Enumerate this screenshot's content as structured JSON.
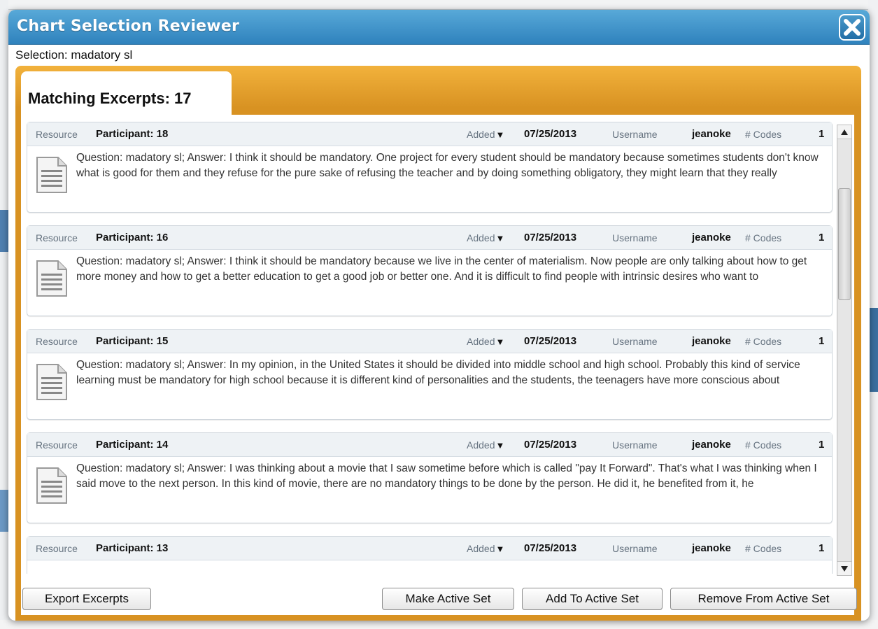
{
  "dialog": {
    "title": "Chart Selection Reviewer",
    "selection_text": "Selection: madatory sl",
    "tab_label": "Matching Excerpts: 17",
    "close_icon": "close-x-icon"
  },
  "columns": {
    "resource_label": "Resource",
    "added_label": "Added",
    "added_sort_icon": "sort-desc-caret",
    "username_label": "Username",
    "codes_label": "# Codes"
  },
  "excerpts": [
    {
      "resource": "Participant: 18",
      "date": "07/25/2013",
      "username": "jeanoke",
      "codes": "1",
      "text": "Question: madatory sl; Answer: I think it should be mandatory. One project for every student should be mandatory because sometimes students don't know what is good for them and they refuse for the pure sake of refusing the teacher and by doing something obligatory, they might learn that they really"
    },
    {
      "resource": "Participant: 16",
      "date": "07/25/2013",
      "username": "jeanoke",
      "codes": "1",
      "text": "Question: madatory sl; Answer: I think it should be mandatory because we live in the center of materialism. Now people are only talking about how to get more money and how to get a better education to get a good job or better one. And it is difficult to find people with intrinsic desires who want to"
    },
    {
      "resource": "Participant: 15",
      "date": "07/25/2013",
      "username": "jeanoke",
      "codes": "1",
      "text": "Question: madatory sl; Answer: In my opinion, in the United States it should be divided into middle school and high school. Probably this kind of service learning must be mandatory for high school because it is different kind of personalities and the students, the teenagers have more conscious about"
    },
    {
      "resource": "Participant: 14",
      "date": "07/25/2013",
      "username": "jeanoke",
      "codes": "1",
      "text": "Question: madatory sl; Answer: I was thinking about a movie that I saw sometime before which is called \"pay It Forward\". That's what I was thinking when I said move to the next person. In this kind of movie, there are no mandatory things to be done by the person. He did it, he benefited from it, he"
    },
    {
      "resource": "Participant: 13",
      "date": "07/25/2013",
      "username": "jeanoke",
      "codes": "1",
      "text": ""
    }
  ],
  "buttons": {
    "export": "Export Excerpts",
    "make_active": "Make Active Set",
    "add_active": "Add To Active Set",
    "remove_active": "Remove From Active Set"
  },
  "colors": {
    "title_bar": "#2f82bd",
    "frame_orange": "#d89222",
    "card_header": "#eef2f5"
  }
}
